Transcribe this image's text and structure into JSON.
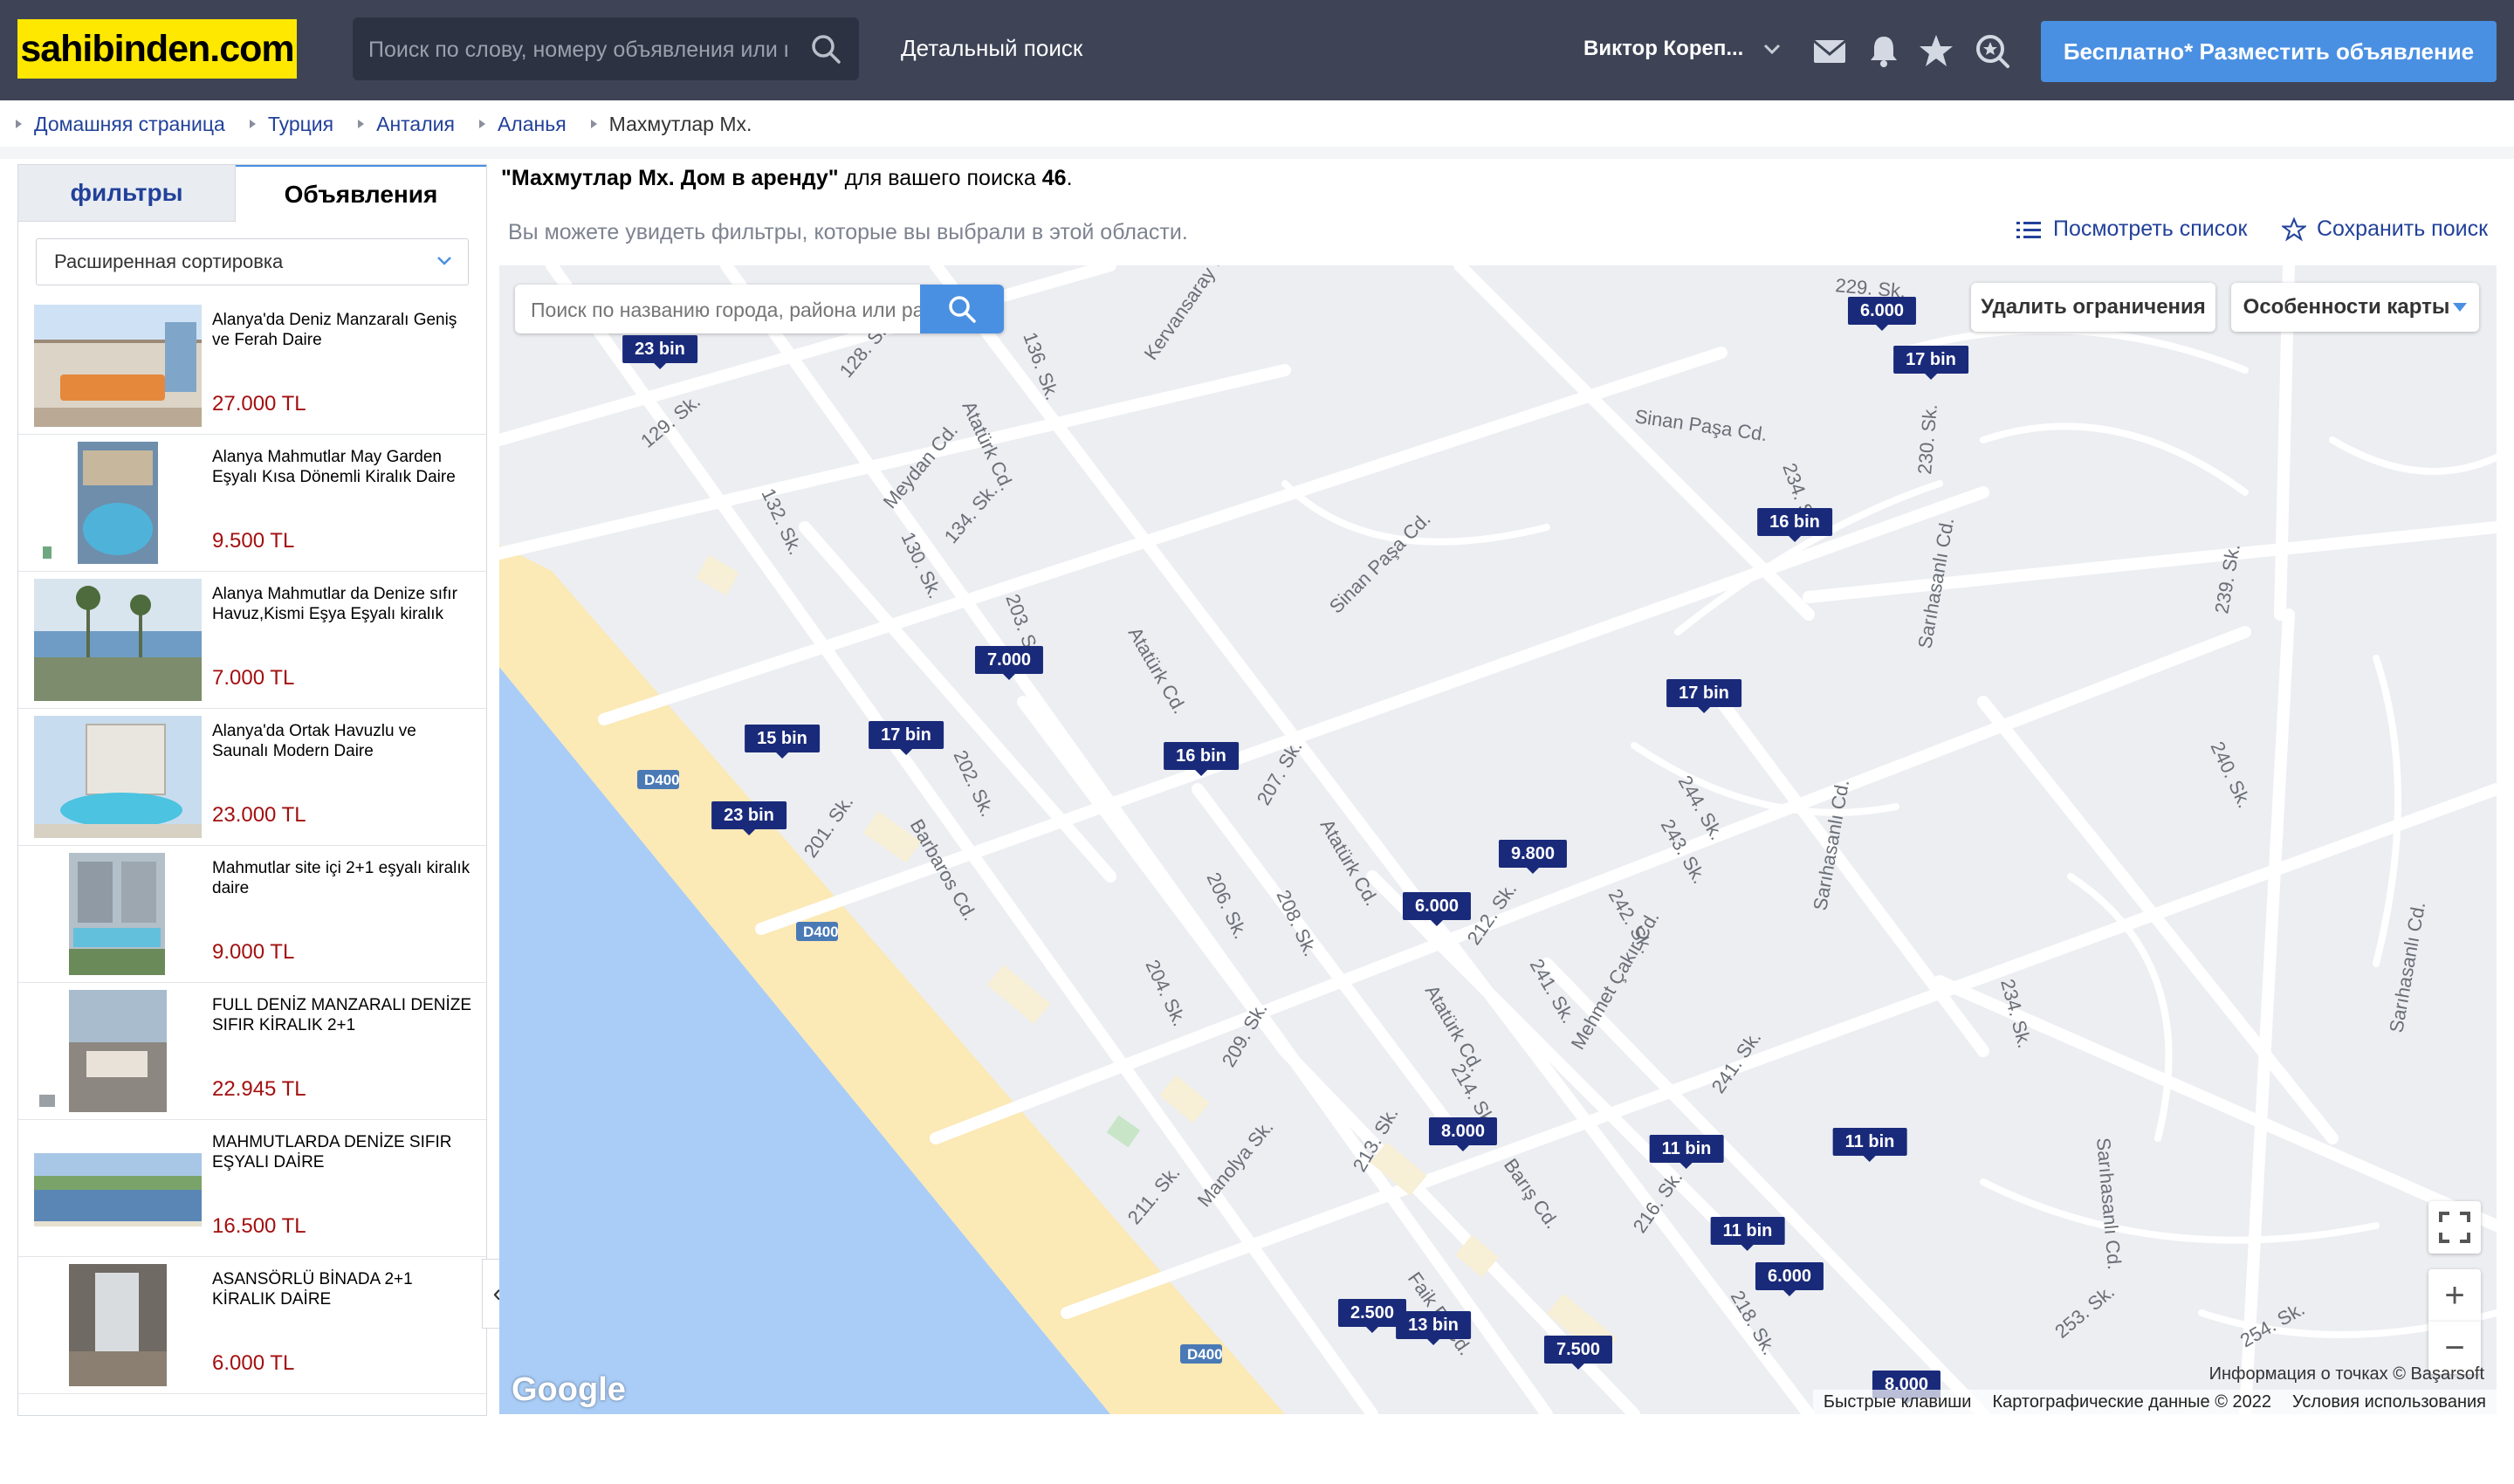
{
  "header": {
    "logo": "sahibinden.com",
    "search_placeholder": "Поиск по слову, номеру объявления или наз",
    "detailed_search": "Детальный поиск",
    "user_name": "Виктор Кореп...",
    "post_button": "Бесплатно* Разместить объявление"
  },
  "breadcrumb": [
    "Домашняя страница",
    "Турция",
    "Анталия",
    "Аланья",
    "Махмутлар Мх."
  ],
  "sidebar": {
    "tab_filters": "фильтры",
    "tab_listings": "Объявления",
    "sort_label": "Расширенная сортировка",
    "listings": [
      {
        "title": "Alanya'da Deniz Manzaralı Geniş ve Ferah Daire",
        "price": "27.000 TL"
      },
      {
        "title": "Alanya Mahmutlar May Garden Eşyalı Kısa Dönemli Kiralık Daire",
        "price": "9.500 TL"
      },
      {
        "title": "Alanya Mahmutlar da Denize sıfır Havuz,Kismi Eşya Eşyalı kiralık",
        "price": "7.000 TL"
      },
      {
        "title": "Alanya'da Ortak Havuzlu ve Saunalı Modern Daire",
        "price": "23.000 TL"
      },
      {
        "title": "Mahmutlar site içi 2+1 eşyalı kiralık daire",
        "price": "9.000 TL"
      },
      {
        "title": "FULL DENİZ MANZARALI DENİZE SIFIR KİRALIK 2+1",
        "price": "22.945 TL"
      },
      {
        "title": "MAHMUTLARDA DENİZE SIFIR EŞYALI DAİRE",
        "price": "16.500 TL"
      },
      {
        "title": "ASANSÖRLÜ BİNADA 2+1 KİRALIK DAİRE",
        "price": "6.000 TL"
      }
    ]
  },
  "results": {
    "query": "\"Махмутлар Мх. Дом в аренду\"",
    "middle": " для вашего поиска ",
    "count": "46",
    "end": ".",
    "hint": "Вы можете увидеть фильтры, которые вы выбрали в этой области.",
    "view_list": "Посмотреть список",
    "save_search": "Сохранить поиск"
  },
  "map": {
    "search_placeholder": "Поиск по названию города, района или ра",
    "remove_limits": "Удалить ограничения",
    "map_features": "Особенности карты",
    "pins": [
      "23 bin",
      "6.000",
      "17 bin",
      "16 bin",
      "7.000",
      "17 bin",
      "15 bin",
      "17 bin",
      "16 bin",
      "23 bin",
      "9.800",
      "6.000",
      "8.000",
      "11 bin",
      "11 bin",
      "11 bin",
      "6.000",
      "2.500",
      "13 bin",
      "7.500",
      "8.000"
    ],
    "roads": [
      "Kervansaray Cd.",
      "Atatürk Cd.",
      "Sinan Paşa Cd.",
      "Meydan Cd.",
      "Barbaros Cd.",
      "Mehmet Çakır Cd.",
      "Sarıhasanlı Cd.",
      "Manolya Sk.",
      "Barış Cd.",
      "Faik Er Cd.",
      "128. Sk.",
      "129. Sk.",
      "130. Sk.",
      "132. Sk.",
      "134. Sk.",
      "136. Sk.",
      "201. Sk.",
      "202. Sk.",
      "203. Sk.",
      "204. Sk.",
      "206. Sk.",
      "207. Sk.",
      "208. Sk.",
      "209. Sk.",
      "211. Sk.",
      "212. Sk.",
      "213. Sk.",
      "214. Sk.",
      "216. Sk.",
      "218. Sk.",
      "229. Sk.",
      "230. Sk.",
      "234. Sk.",
      "239. Sk.",
      "240. Sk.",
      "241. Sk.",
      "242. Sk.",
      "243. Sk.",
      "244. Sk.",
      "253. Sk.",
      "254. Sk.",
      "D400"
    ],
    "google": "Google",
    "attribution": "Информация о точках © Başarsoft",
    "footer": [
      "Быстрые клавиши",
      "Картографические данные © 2022",
      "Условия использования"
    ]
  },
  "colors": {
    "topbar": "#3e4456",
    "logo_bg": "#ffe800",
    "accent": "#4a90e2",
    "pin": "#1a2a7a",
    "price": "#a30f0f",
    "sea": "#a9cdf7",
    "beach": "#fbe9b6"
  }
}
